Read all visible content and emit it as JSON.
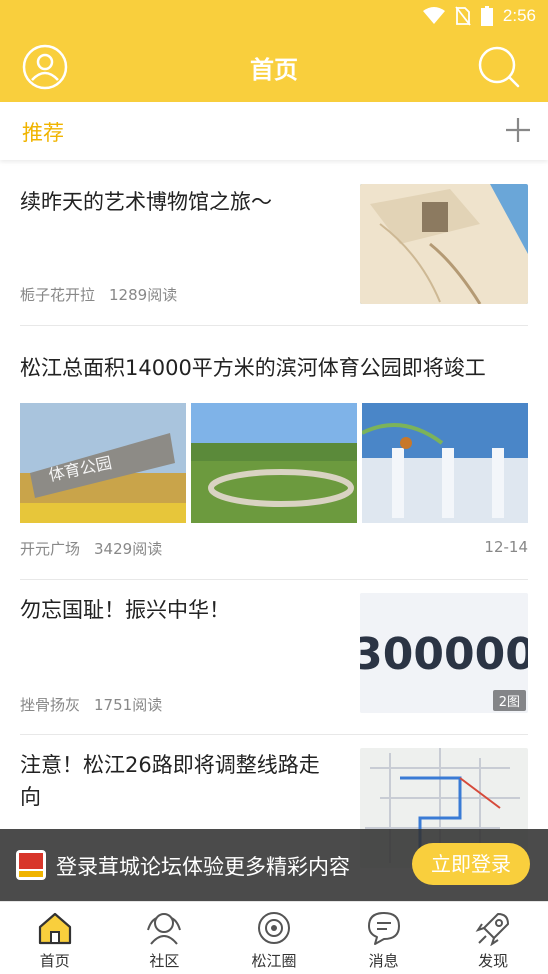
{
  "status": {
    "time": "2:56"
  },
  "header": {
    "title": "首页"
  },
  "channel": {
    "active_tab": "推荐"
  },
  "articles": [
    {
      "title": "续昨天的艺术博物馆之旅～",
      "author": "栀子花开拉",
      "reads": "1289阅读"
    },
    {
      "title": "松江总面积14000平方米的滨河体育公园即将竣工",
      "author": "开元广场",
      "reads": "3429阅读",
      "date": "12-14"
    },
    {
      "title": "勿忘国耻！振兴中华！",
      "author": "挫骨扬灰",
      "reads": "1751阅读",
      "image_count": "2图",
      "image_text": "300000"
    },
    {
      "title": "注意！松江26路即将调整线路走向"
    }
  ],
  "login_banner": {
    "text": "登录茸城论坛体验更多精彩内容",
    "button": "立即登录"
  },
  "nav": [
    {
      "label": "首页",
      "icon": "home-icon",
      "active": true
    },
    {
      "label": "社区",
      "icon": "community-icon",
      "active": false
    },
    {
      "label": "松江圈",
      "icon": "songjiang-circle-icon",
      "active": false
    },
    {
      "label": "消息",
      "icon": "message-icon",
      "active": false
    },
    {
      "label": "发现",
      "icon": "discover-icon",
      "active": false
    }
  ],
  "colors": {
    "brand": "#f9cf3d",
    "accent_text": "#f0b400"
  }
}
